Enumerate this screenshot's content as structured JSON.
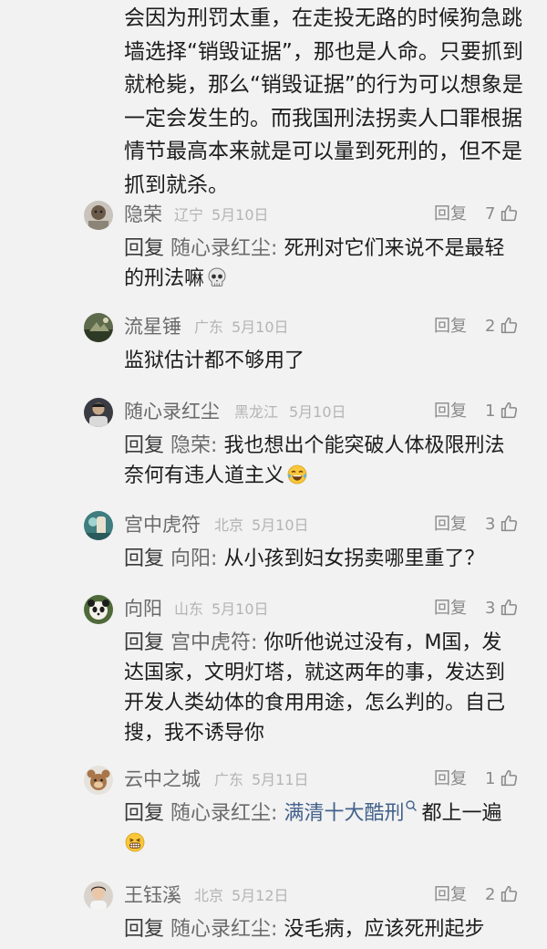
{
  "top_text": "会因为刑罚太重，在走投无路的时候狗急跳墙选择“销毁证据”，那也是人命。只要抓到就枪毙，那么“销毁证据”的行为可以想象是一定会发生的。而我国刑法拐卖人口罪根据情节最高本来就是可以量到死刑的，但不是抓到就杀。",
  "ui": {
    "reply_label": "回复",
    "reply_prefix": "回复"
  },
  "comments": [
    {
      "name": "隐荣",
      "location": "辽宁",
      "date": "5月10日",
      "likes": "7",
      "reply_to": "随心录红尘",
      "text": "死刑对它们来说不是最轻的刑法嘛",
      "emoji": "skull-emoji"
    },
    {
      "name": "流星锤",
      "location": "广东",
      "date": "5月10日",
      "likes": "2",
      "text": "监狱估计都不够用了"
    },
    {
      "name": "随心录红尘",
      "location": "黑龙江",
      "date": "5月10日",
      "likes": "1",
      "reply_to": "隐荣",
      "text": "我也想出个能突破人体极限刑法奈何有违人道主义",
      "emoji": "laugh-cry-emoji"
    },
    {
      "name": "宫中虎符",
      "location": "北京",
      "date": "5月10日",
      "likes": "3",
      "reply_to": "向阳",
      "text": "从小孩到妇女拐卖哪里重了？"
    },
    {
      "name": "向阳",
      "location": "山东",
      "date": "5月10日",
      "likes": "3",
      "reply_to": "宫中虎符",
      "text": "你听他说过没有，M国，发达国家，文明灯塔，就这两年的事，发达到开发人类幼体的食用用途，怎么判的。自己搜，我不诱导你"
    },
    {
      "name": "云中之城",
      "location": "广东",
      "date": "5月11日",
      "likes": "1",
      "reply_to": "随心录红尘",
      "topic": "满清十大酷刑",
      "text": "都上一遍",
      "emoji": "grin-emoji"
    },
    {
      "name": "王钰溪",
      "location": "北京",
      "date": "5月12日",
      "likes": "2",
      "reply_to": "随心录红尘",
      "text": "没毛病，应该死刑起步"
    }
  ],
  "colors": {
    "background": "#f2f2f2",
    "text": "#1c1c1c",
    "username": "#6a6a6a",
    "meta": "#b4b4b4",
    "topic_link": "#43628c"
  }
}
